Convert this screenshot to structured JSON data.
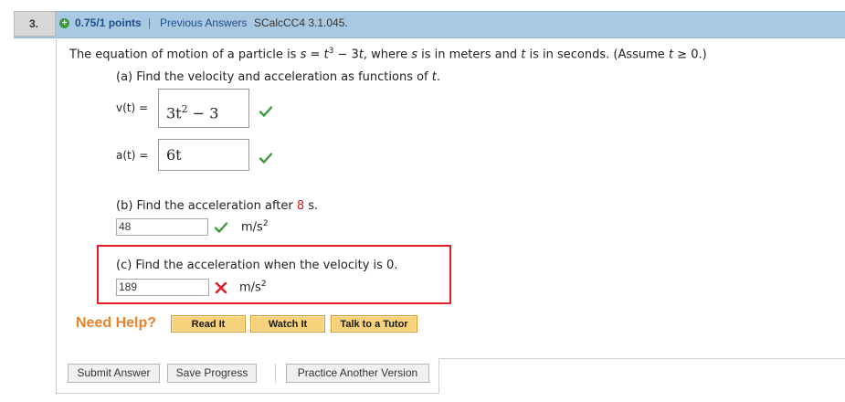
{
  "header": {
    "question_number": "3.",
    "points": "0.75/1 points",
    "separator": "|",
    "previous_answers": "Previous Answers",
    "source": "SCalcCC4 3.1.045."
  },
  "problem": {
    "intro_1": "The equation of motion of a particle is ",
    "s_var": "s",
    "eq_mid": " = ",
    "t_var": "t",
    "exp_3": "3",
    "eq_rest": " − 3",
    "t_var2": "t",
    "intro_2": ",  where ",
    "s_var2": "s",
    "intro_3": " is in meters and ",
    "t_var3": "t",
    "intro_4": " is in seconds. (Assume ",
    "t_var4": "t",
    "intro_5": " ≥ 0.)"
  },
  "part_a": {
    "prompt": "(a) Find the velocity and acceleration as functions of ",
    "prompt_var": "t",
    "prompt_end": ".",
    "v_label": "v(t) = ",
    "v_value_base": "3t",
    "v_value_exp": "2",
    "v_value_rest": " − 3",
    "a_label": "a(t) = ",
    "a_value": "6t"
  },
  "part_b": {
    "prompt": "(b) Find the acceleration after ",
    "highlight": "8",
    "prompt_end": " s.",
    "value": "48",
    "unit_base": "m/s",
    "unit_exp": "2"
  },
  "part_c": {
    "prompt": "(c) Find the acceleration when the velocity is 0.",
    "value": "189",
    "unit_base": "m/s",
    "unit_exp": "2"
  },
  "help": {
    "label": "Need Help?",
    "buttons": [
      "Read It",
      "Watch It",
      "Talk to a Tutor"
    ]
  },
  "footer": {
    "submit": "Submit Answer",
    "save": "Save Progress",
    "practice": "Practice Another Version"
  },
  "colors": {
    "header_bg": "#a9c9e3",
    "correct": "#3a9b3a",
    "incorrect": "#e41e24",
    "help_orange": "#e8822a"
  }
}
